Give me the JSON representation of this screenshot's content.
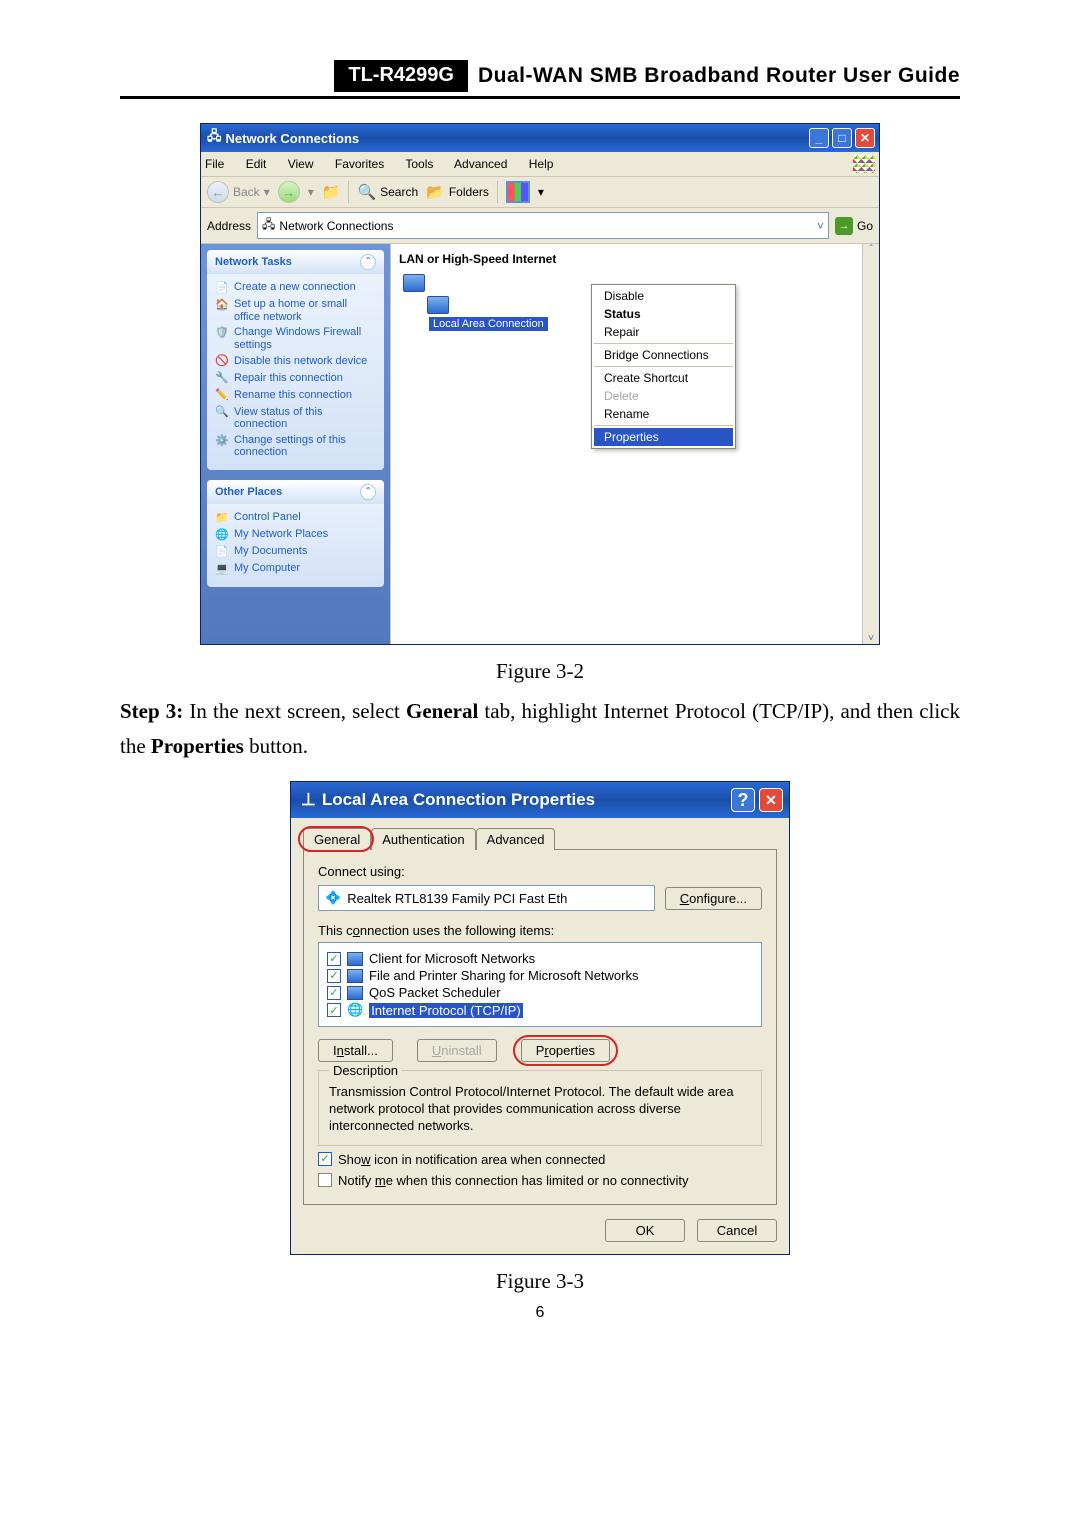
{
  "header": {
    "model": "TL-R4299G",
    "title": "Dual-WAN SMB Broadband Router User Guide"
  },
  "fig1": {
    "title": "Network Connections",
    "menus": [
      "File",
      "Edit",
      "View",
      "Favorites",
      "Tools",
      "Advanced",
      "Help"
    ],
    "toolbar": {
      "back": "Back",
      "search": "Search",
      "folders": "Folders"
    },
    "address_label": "Address",
    "address_value": "Network Connections",
    "go": "Go",
    "tasks_head": "Network Tasks",
    "tasks": [
      "Create a new connection",
      "Set up a home or small office network",
      "Change Windows Firewall settings",
      "Disable this network device",
      "Repair this connection",
      "Rename this connection",
      "View status of this connection",
      "Change settings of this connection"
    ],
    "other_head": "Other Places",
    "other": [
      "Control Panel",
      "My Network Places",
      "My Documents",
      "My Computer"
    ],
    "category": "LAN or High-Speed Internet",
    "conn_label": "Local Area Connection",
    "ctx": {
      "disable": "Disable",
      "status": "Status",
      "repair": "Repair",
      "bridge": "Bridge Connections",
      "shortcut": "Create Shortcut",
      "delete": "Delete",
      "rename": "Rename",
      "properties": "Properties"
    }
  },
  "caption1": "Figure 3-2",
  "step3": {
    "label": "Step 3:",
    "pre": " In the next screen, select ",
    "general": "General",
    "mid": " tab, highlight Internet Protocol (TCP/IP), and then click the ",
    "properties": "Properties",
    "post": " button."
  },
  "fig2": {
    "title": "Local Area Connection Properties",
    "tabs": {
      "general": "General",
      "auth": "Authentication",
      "adv": "Advanced"
    },
    "connect_using": "Connect using:",
    "adapter": "Realtek RTL8139 Family PCI Fast Eth",
    "configure": "Configure...",
    "uses_label": "This connection uses the following items:",
    "items": [
      "Client for Microsoft Networks",
      "File and Printer Sharing for Microsoft Networks",
      "QoS Packet Scheduler",
      "Internet Protocol (TCP/IP)"
    ],
    "install": "Install...",
    "uninstall": "Uninstall",
    "properties": "Properties",
    "desc_head": "Description",
    "desc": "Transmission Control Protocol/Internet Protocol. The default wide area network protocol that provides communication across diverse interconnected networks.",
    "show_icon": "Show icon in notification area when connected",
    "notify": "Notify me when this connection has limited or no connectivity",
    "ok": "OK",
    "cancel": "Cancel"
  },
  "caption2": "Figure 3-3",
  "page_number": "6"
}
